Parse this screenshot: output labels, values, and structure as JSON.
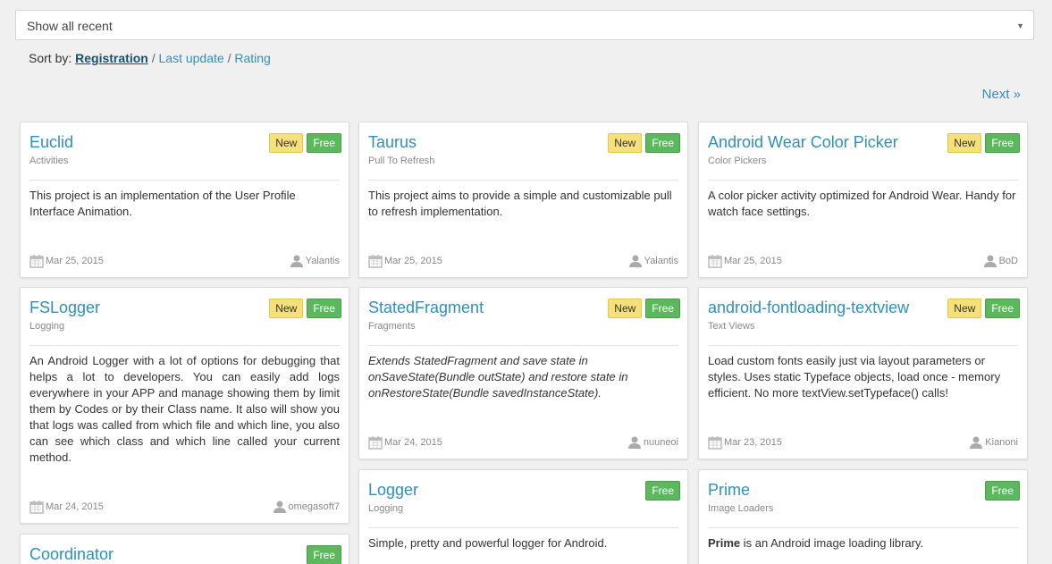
{
  "filter": {
    "selected": "Show all recent"
  },
  "sort": {
    "label": "Sort by:",
    "options": [
      "Registration",
      "Last update",
      "Rating"
    ],
    "active": "Registration",
    "separator": "/"
  },
  "pagination": {
    "next_label": "Next »"
  },
  "cards": [
    {
      "title": "Euclid",
      "category": "Activities",
      "badges": [
        "New",
        "Free"
      ],
      "description": "This project is an implementation of the User Profile Interface Animation.",
      "date": "Mar 25, 2015",
      "author": "Yalantis"
    },
    {
      "title": "Taurus",
      "category": "Pull To Refresh",
      "badges": [
        "New",
        "Free"
      ],
      "description": "This project aims to provide a simple and customizable pull to refresh implementation.",
      "date": "Mar 25, 2015",
      "author": "Yalantis"
    },
    {
      "title": "Android Wear Color Picker",
      "category": "Color Pickers",
      "badges": [
        "New",
        "Free"
      ],
      "description": "A color picker activity optimized for Android Wear. Handy for watch face settings.",
      "date": "Mar 25, 2015",
      "author": "BoD"
    },
    {
      "title": "FSLogger",
      "category": "Logging",
      "badges": [
        "New",
        "Free"
      ],
      "description": "An Android Logger with a lot of options for debugging that helps a lot to developers. You can easily add logs everywhere in your APP and manage showing them by limit them by Codes or by their Class name. It also will show you that logs was called from which file and which line, you also can see which class and which line called your current method.",
      "date": "Mar 24, 2015",
      "author": "omegasoft7"
    },
    {
      "title": "StatedFragment",
      "category": "Fragments",
      "badges": [
        "New",
        "Free"
      ],
      "description": "Extends StatedFragment and save state in onSaveState(Bundle outState) and restore state in onRestoreState(Bundle savedInstanceState).",
      "date": "Mar 24, 2015",
      "author": "nuuneoi"
    },
    {
      "title": "android-fontloading-textview",
      "category": "Text Views",
      "badges": [
        "New",
        "Free"
      ],
      "description": "Load custom fonts easily just via layout parameters or styles. Uses static Typeface objects, load once - memory efficient. No more textView.setTypeface() calls!",
      "date": "Mar 23, 2015",
      "author": "Kianoni"
    },
    {
      "title": "Logger",
      "category": "Logging",
      "badges": [
        "Free"
      ],
      "description": "Simple, pretty and powerful logger for Android."
    },
    {
      "title": "Prime",
      "category": "Image Loaders",
      "badges": [
        "Free"
      ],
      "description_strong": "Prime",
      "description": " is an Android image loading library."
    },
    {
      "title": "Coordinator",
      "badges": [
        "Free"
      ]
    }
  ],
  "colors": {
    "link": "#2f8fbd",
    "new_badge": "#f5e079",
    "free_badge": "#5cb85c"
  }
}
